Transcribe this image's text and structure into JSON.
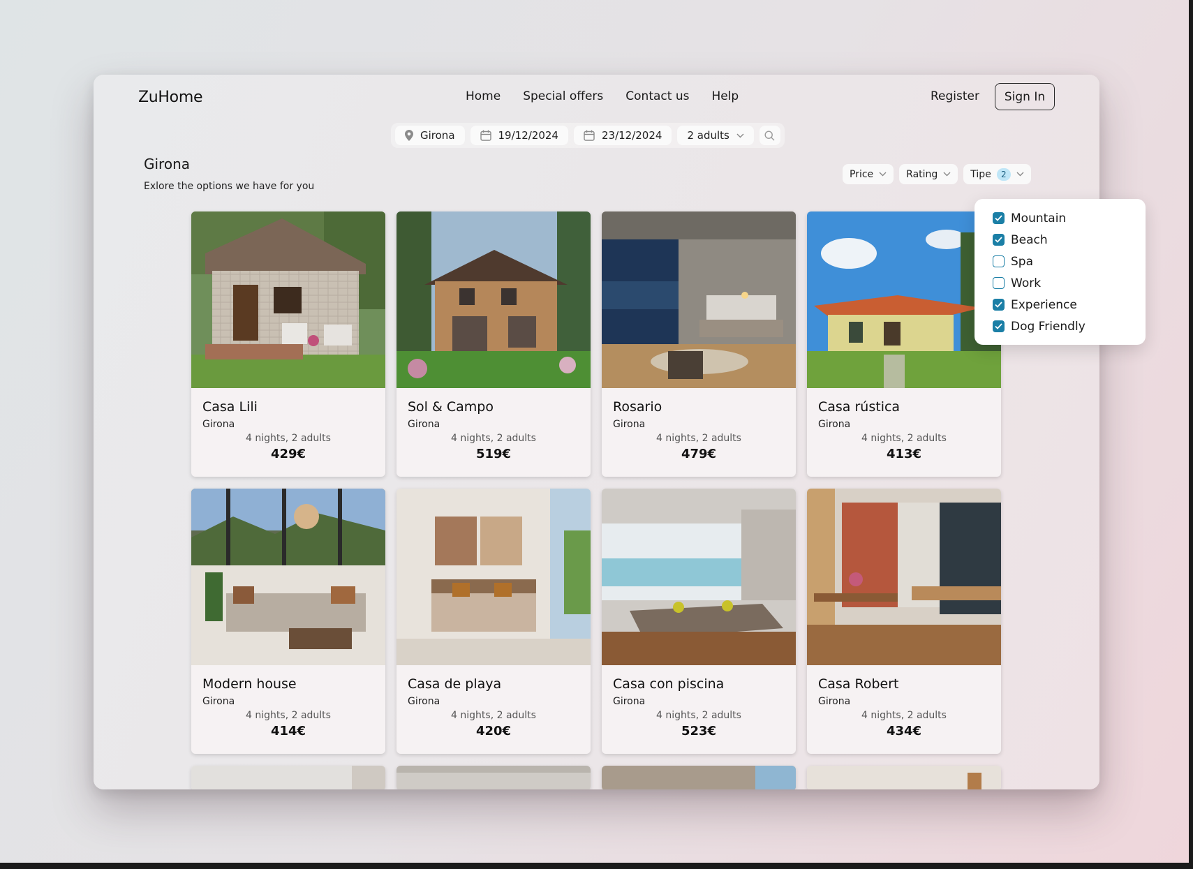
{
  "app": {
    "logo": "ZuHome"
  },
  "nav": {
    "items": [
      "Home",
      "Special offers",
      "Contact us",
      "Help"
    ],
    "register": "Register",
    "signin": "Sign In"
  },
  "search": {
    "location": "Girona",
    "checkin": "19/12/2024",
    "checkout": "23/12/2024",
    "guests": "2 adults"
  },
  "page": {
    "title": "Girona",
    "subtitle": "Exlore the options we have for you"
  },
  "filters": {
    "price": "Price",
    "rating": "Rating",
    "type": "Tipe",
    "type_count": "2"
  },
  "type_options": [
    {
      "label": "Mountain",
      "checked": true
    },
    {
      "label": "Beach",
      "checked": true
    },
    {
      "label": "Spa",
      "checked": false
    },
    {
      "label": "Work",
      "checked": false
    },
    {
      "label": "Experience",
      "checked": true
    },
    {
      "label": "Dog Friendly",
      "checked": true
    }
  ],
  "listings": [
    {
      "name": "Casa Lili",
      "location": "Girona",
      "stay": "4 nights, 2 adults",
      "price": "429€",
      "scene": "stone-cottage"
    },
    {
      "name": "Sol & Campo",
      "location": "Girona",
      "stay": "4 nights, 2 adults",
      "price": "519€",
      "scene": "brick-house"
    },
    {
      "name": "Rosario",
      "location": "Girona",
      "stay": "4 nights, 2 adults",
      "price": "479€",
      "scene": "modern-bedroom"
    },
    {
      "name": "Casa rústica",
      "location": "Girona",
      "stay": "4 nights, 2 adults",
      "price": "413€",
      "scene": "villa-garden"
    },
    {
      "name": "Modern house",
      "location": "Girona",
      "stay": "4 nights, 2 adults",
      "price": "414€",
      "scene": "living-mountains"
    },
    {
      "name": "Casa de playa",
      "location": "Girona",
      "stay": "4 nights, 2 adults",
      "price": "420€",
      "scene": "beach-bedroom"
    },
    {
      "name": "Casa con piscina",
      "location": "Girona",
      "stay": "4 nights, 2 adults",
      "price": "523€",
      "scene": "pool-living"
    },
    {
      "name": "Casa Robert",
      "location": "Girona",
      "stay": "4 nights, 2 adults",
      "price": "434€",
      "scene": "brick-kitchen"
    }
  ],
  "colors": {
    "accent": "#1b7fa6",
    "badge_bg": "#bfe6f7"
  }
}
